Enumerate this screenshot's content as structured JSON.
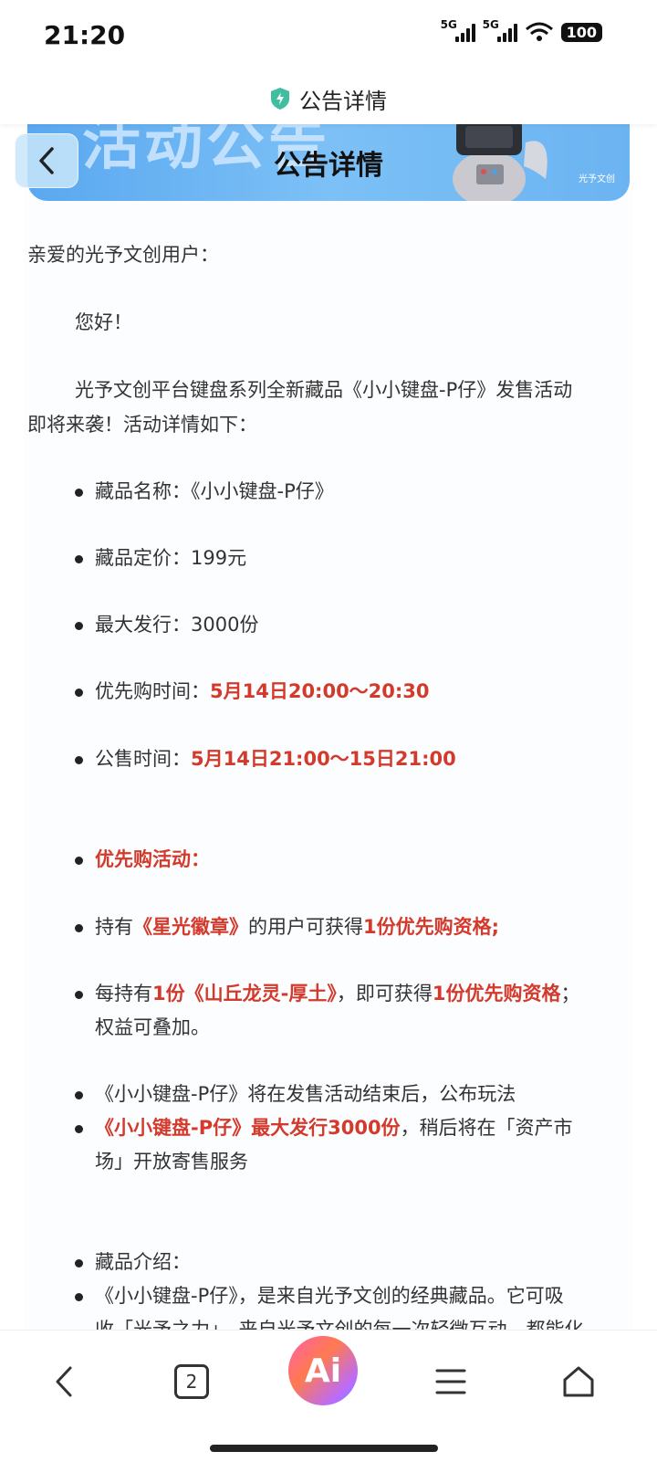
{
  "status": {
    "time": "21:20",
    "network1": "5G",
    "network2": "5G",
    "battery": "100"
  },
  "header": {
    "title": "公告详情"
  },
  "banner": {
    "title": "公告详情",
    "bg_text": "活动公告",
    "tag": "光予文创"
  },
  "article": {
    "greeting": "亲爱的光予文创用户：",
    "hello": "您好！",
    "intro_line1": "光予文创平台键盘系列全新藏品《小小键盘-P仔》发售活动",
    "intro_line2": "即将来袭！活动详情如下：",
    "item_name_label": "藏品名称：",
    "item_name_value": "《小小键盘-P仔》",
    "price_label": "藏品定价：",
    "price_value": "199元",
    "supply_label": "最大发行：",
    "supply_value": "3000份",
    "presale_label": "优先购时间：",
    "presale_value": "5月14日20:00～20:30",
    "public_label": "公售时间：",
    "public_value": "5月14日21:00～15日21:00",
    "priority_title": "优先购活动：",
    "p1_a": "持有",
    "p1_b": "《星光徽章》",
    "p1_c": "的用户可获得",
    "p1_d": "1份优先购资格;",
    "p2_a": "每持有",
    "p2_b": "1份《山丘龙灵-厚土》",
    "p2_c": "，即可获得",
    "p2_d": "1份优先购资格",
    "p2_e": "；",
    "p2_line2": "权益可叠加。",
    "play_note": "《小小键盘-P仔》将在发售活动结束后，公布玩法",
    "resale_red": "《小小键盘-P仔》最大发行3000份",
    "resale_rest": "，稍后将在「资产市",
    "resale_line2": "场」开放寄售服务",
    "intro_title": "藏品介绍：",
    "desc_line1": "《小小键盘-P仔》，是来自光予文创的经典藏品。它可吸",
    "desc_line2": "收「光予之力」，来自光予文创的每一次轻微互动，都能化"
  },
  "nav": {
    "tabs_count": "2",
    "ai_label": "Ai"
  }
}
